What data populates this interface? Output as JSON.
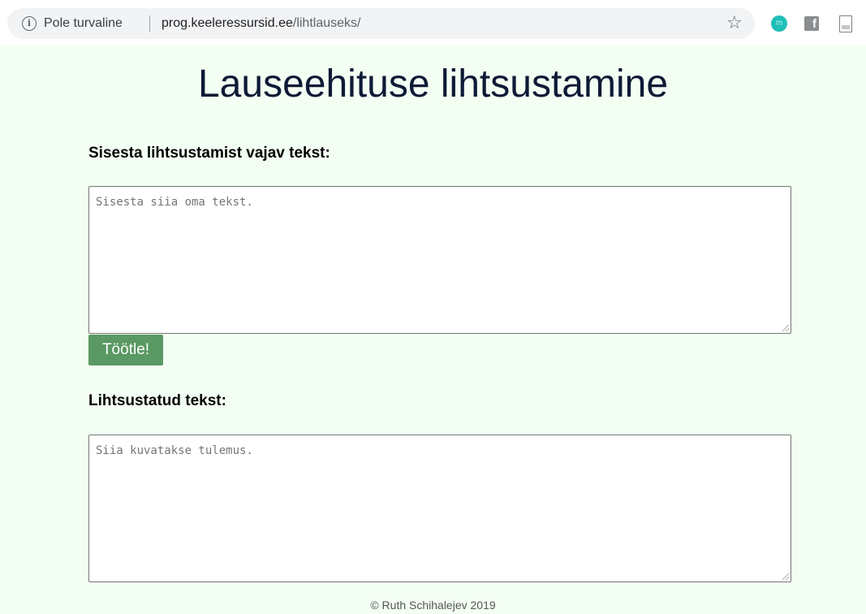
{
  "browser": {
    "security_text": "Pole turvaline",
    "url_domain": "prog.keeleressursid.ee",
    "url_path": "/lihtlauseks/",
    "icons": {
      "info": "info-icon",
      "bookmark": "star-icon",
      "extensions": [
        "m-extension-icon",
        "facebook-icon",
        "document-icon"
      ]
    },
    "ext_m_letter": "m",
    "ext_f_letter": "f"
  },
  "page": {
    "title": "Lauseehituse lihtsustamine",
    "input_label": "Sisesta lihtsustamist vajav tekst:",
    "input_placeholder": "Sisesta siia oma tekst.",
    "submit_label": "Töötle!",
    "output_label": "Lihtsustatud tekst:",
    "output_placeholder": "Siia kuvatakse tulemus.",
    "footer": "© Ruth Schihalejev 2019"
  },
  "colors": {
    "background": "#f4fff3",
    "button": "#5a9963",
    "title": "#0e1a36"
  }
}
